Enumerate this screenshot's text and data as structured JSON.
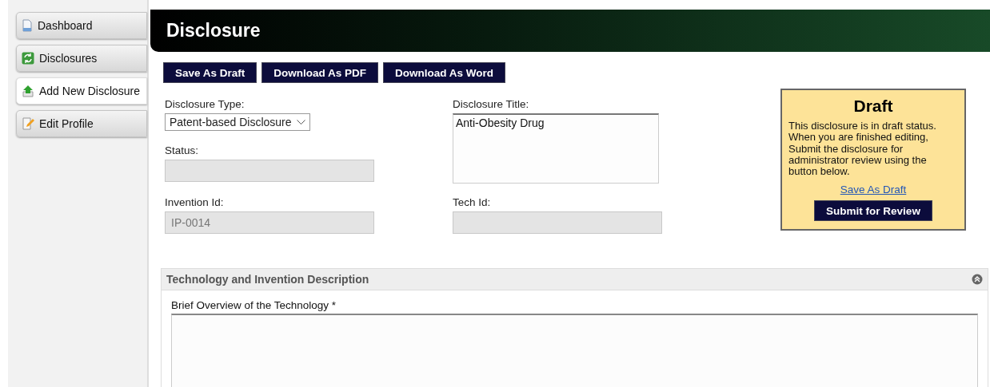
{
  "sidebar": {
    "items": [
      {
        "label": "Dashboard",
        "selected": false
      },
      {
        "label": "Disclosures",
        "selected": false
      },
      {
        "label": "Add New Disclosure",
        "selected": true
      },
      {
        "label": "Edit Profile",
        "selected": false
      }
    ]
  },
  "header": {
    "title": "Disclosure"
  },
  "toolbar": {
    "buttons": [
      "Save As Draft",
      "Download As PDF",
      "Download As Word"
    ]
  },
  "form": {
    "left": [
      {
        "kind": "select",
        "label": "Disclosure Type:",
        "value": "Patent-based Disclosure",
        "disabled": false
      },
      {
        "kind": "text",
        "label": "Status:",
        "disabled": true
      },
      {
        "kind": "text",
        "label": "Invention Id:",
        "value": "IP-0014",
        "disabled": true
      }
    ],
    "right": [
      {
        "kind": "textarea",
        "label": "Disclosure Title:",
        "value": "Anti-Obesity Drug",
        "disabled": false
      },
      {
        "kind": "text",
        "label": "Tech Id:",
        "disabled": true
      }
    ]
  },
  "status_panel": {
    "title": "Draft",
    "message": "This disclosure is in draft status. When you are finished editing, Submit the disclosure for administrator review using the button below.",
    "link": "Save As Draft",
    "button": "Submit for Review"
  },
  "section": {
    "title": "Technology and Invention Description",
    "expanded": true,
    "field_label": "Brief Overview of the Technology *"
  }
}
